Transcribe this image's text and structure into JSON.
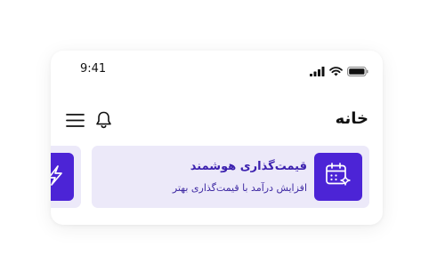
{
  "status_bar": {
    "time": "9:41",
    "icons": [
      "signal-icon",
      "wifi-icon",
      "battery-icon"
    ]
  },
  "header": {
    "title": "خانه",
    "icons": [
      "bell-icon",
      "hamburger-menu-icon"
    ]
  },
  "feature_cards": [
    {
      "title": "قیمت‌گذاری هوشمند",
      "subtitle": "افزایش درآمد با قیمت‌گذاری بهتر",
      "icon": "calendar-sparkle-icon"
    },
    {
      "title": "",
      "subtitle": "",
      "icon": "lightning-icon"
    }
  ],
  "colors": {
    "accent": "#4c24d6",
    "card_bg": "#ece9f9",
    "title_text": "#3a1fae"
  }
}
